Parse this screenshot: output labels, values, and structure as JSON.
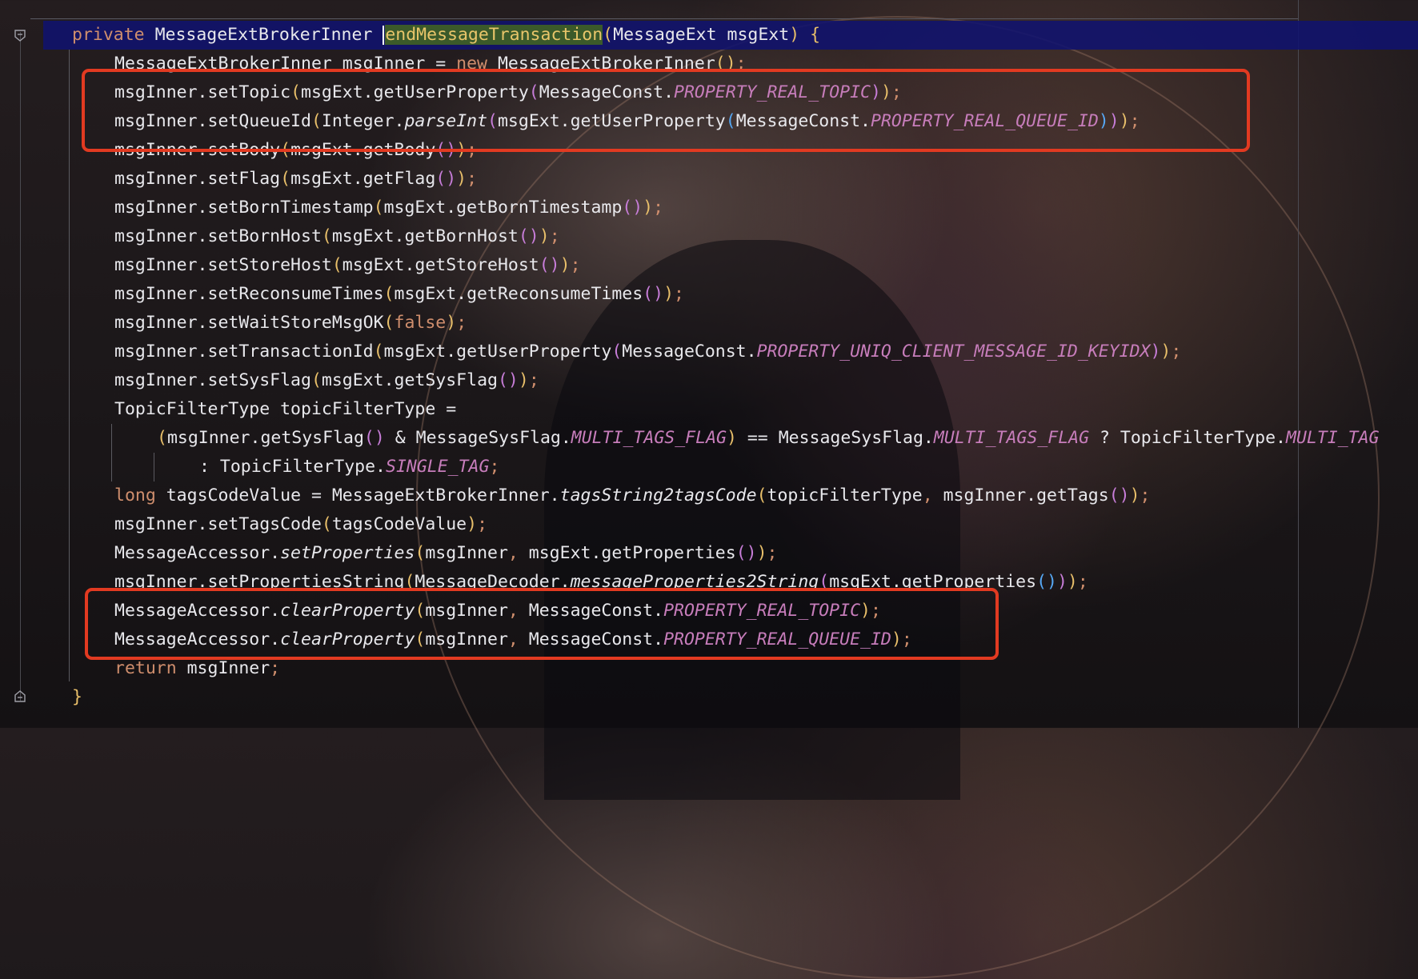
{
  "editor": {
    "lines": [
      {
        "indent": 0,
        "highlighted": true,
        "segments": [
          {
            "t": "private ",
            "c": "kw"
          },
          {
            "t": "MessageExtBrokerInner ",
            "c": "fn"
          },
          {
            "t": "",
            "c": "caret"
          },
          {
            "t": "endMessageTransaction",
            "c": "sel"
          },
          {
            "t": "(",
            "c": "p1"
          },
          {
            "t": "MessageExt msgExt",
            "c": "fn"
          },
          {
            "t": ") {",
            "c": "p1"
          }
        ]
      },
      {
        "indent": 1,
        "segments": [
          {
            "t": "MessageExtBrokerInner msgInner = ",
            "c": "fn"
          },
          {
            "t": "new ",
            "c": "kw"
          },
          {
            "t": "MessageExtBrokerInner",
            "c": "fn"
          },
          {
            "t": "()",
            "c": "p1"
          },
          {
            "t": ";",
            "c": "punc"
          }
        ]
      },
      {
        "indent": 1,
        "segments": [
          {
            "t": "msgInner.setTopic",
            "c": "fn"
          },
          {
            "t": "(",
            "c": "p1"
          },
          {
            "t": "msgExt.getUserProperty",
            "c": "fn"
          },
          {
            "t": "(",
            "c": "p2"
          },
          {
            "t": "MessageConst.",
            "c": "fn"
          },
          {
            "t": "PROPERTY_REAL_TOPIC",
            "c": "const"
          },
          {
            "t": ")",
            "c": "p2"
          },
          {
            "t": ")",
            "c": "p1"
          },
          {
            "t": ";",
            "c": "punc"
          }
        ]
      },
      {
        "indent": 1,
        "segments": [
          {
            "t": "msgInner.setQueueId",
            "c": "fn"
          },
          {
            "t": "(",
            "c": "p1"
          },
          {
            "t": "Integer.",
            "c": "fn"
          },
          {
            "t": "parseInt",
            "c": "st"
          },
          {
            "t": "(",
            "c": "p2"
          },
          {
            "t": "msgExt.getUserProperty",
            "c": "fn"
          },
          {
            "t": "(",
            "c": "p3"
          },
          {
            "t": "MessageConst.",
            "c": "fn"
          },
          {
            "t": "PROPERTY_REAL_QUEUE_ID",
            "c": "const"
          },
          {
            "t": ")",
            "c": "p3"
          },
          {
            "t": ")",
            "c": "p2"
          },
          {
            "t": ")",
            "c": "p1"
          },
          {
            "t": ";",
            "c": "punc"
          }
        ]
      },
      {
        "indent": 1,
        "segments": [
          {
            "t": "msgInner.setBody",
            "c": "fn"
          },
          {
            "t": "(",
            "c": "p1"
          },
          {
            "t": "msgExt.getBody",
            "c": "fn"
          },
          {
            "t": "()",
            "c": "p2"
          },
          {
            "t": ")",
            "c": "p1"
          },
          {
            "t": ";",
            "c": "punc"
          }
        ]
      },
      {
        "indent": 1,
        "segments": [
          {
            "t": "msgInner.setFlag",
            "c": "fn"
          },
          {
            "t": "(",
            "c": "p1"
          },
          {
            "t": "msgExt.getFlag",
            "c": "fn"
          },
          {
            "t": "()",
            "c": "p2"
          },
          {
            "t": ")",
            "c": "p1"
          },
          {
            "t": ";",
            "c": "punc"
          }
        ]
      },
      {
        "indent": 1,
        "segments": [
          {
            "t": "msgInner.setBornTimestamp",
            "c": "fn"
          },
          {
            "t": "(",
            "c": "p1"
          },
          {
            "t": "msgExt.getBornTimestamp",
            "c": "fn"
          },
          {
            "t": "()",
            "c": "p2"
          },
          {
            "t": ")",
            "c": "p1"
          },
          {
            "t": ";",
            "c": "punc"
          }
        ]
      },
      {
        "indent": 1,
        "segments": [
          {
            "t": "msgInner.setBornHost",
            "c": "fn"
          },
          {
            "t": "(",
            "c": "p1"
          },
          {
            "t": "msgExt.getBornHost",
            "c": "fn"
          },
          {
            "t": "()",
            "c": "p2"
          },
          {
            "t": ")",
            "c": "p1"
          },
          {
            "t": ";",
            "c": "punc"
          }
        ]
      },
      {
        "indent": 1,
        "segments": [
          {
            "t": "msgInner.setStoreHost",
            "c": "fn"
          },
          {
            "t": "(",
            "c": "p1"
          },
          {
            "t": "msgExt.getStoreHost",
            "c": "fn"
          },
          {
            "t": "()",
            "c": "p2"
          },
          {
            "t": ")",
            "c": "p1"
          },
          {
            "t": ";",
            "c": "punc"
          }
        ]
      },
      {
        "indent": 1,
        "segments": [
          {
            "t": "msgInner.setReconsumeTimes",
            "c": "fn"
          },
          {
            "t": "(",
            "c": "p1"
          },
          {
            "t": "msgExt.getReconsumeTimes",
            "c": "fn"
          },
          {
            "t": "()",
            "c": "p2"
          },
          {
            "t": ")",
            "c": "p1"
          },
          {
            "t": ";",
            "c": "punc"
          }
        ]
      },
      {
        "indent": 1,
        "segments": [
          {
            "t": "msgInner.setWaitStoreMsgOK",
            "c": "fn"
          },
          {
            "t": "(",
            "c": "p1"
          },
          {
            "t": "false",
            "c": "kw"
          },
          {
            "t": ")",
            "c": "p1"
          },
          {
            "t": ";",
            "c": "punc"
          }
        ]
      },
      {
        "indent": 1,
        "segments": [
          {
            "t": "msgInner.setTransactionId",
            "c": "fn"
          },
          {
            "t": "(",
            "c": "p1"
          },
          {
            "t": "msgExt.getUserProperty",
            "c": "fn"
          },
          {
            "t": "(",
            "c": "p2"
          },
          {
            "t": "MessageConst.",
            "c": "fn"
          },
          {
            "t": "PROPERTY_UNIQ_CLIENT_MESSAGE_ID_KEYIDX",
            "c": "const"
          },
          {
            "t": ")",
            "c": "p2"
          },
          {
            "t": ")",
            "c": "p1"
          },
          {
            "t": ";",
            "c": "punc"
          }
        ]
      },
      {
        "indent": 1,
        "segments": [
          {
            "t": "msgInner.setSysFlag",
            "c": "fn"
          },
          {
            "t": "(",
            "c": "p1"
          },
          {
            "t": "msgExt.getSysFlag",
            "c": "fn"
          },
          {
            "t": "()",
            "c": "p2"
          },
          {
            "t": ")",
            "c": "p1"
          },
          {
            "t": ";",
            "c": "punc"
          }
        ]
      },
      {
        "indent": 1,
        "segments": [
          {
            "t": "TopicFilterType topicFilterType =",
            "c": "fn"
          }
        ]
      },
      {
        "indent": 2,
        "segments": [
          {
            "t": "(",
            "c": "p1"
          },
          {
            "t": "msgInner.getSysFlag",
            "c": "fn"
          },
          {
            "t": "()",
            "c": "p2"
          },
          {
            "t": " & MessageSysFlag.",
            "c": "fn"
          },
          {
            "t": "MULTI_TAGS_FLAG",
            "c": "const"
          },
          {
            "t": ")",
            "c": "p1"
          },
          {
            "t": " == MessageSysFlag.",
            "c": "fn"
          },
          {
            "t": "MULTI_TAGS_FLAG",
            "c": "const"
          },
          {
            "t": " ? TopicFilterType.",
            "c": "fn"
          },
          {
            "t": "MULTI_TAG",
            "c": "const"
          }
        ]
      },
      {
        "indent": 3,
        "segments": [
          {
            "t": ": TopicFilterType.",
            "c": "fn"
          },
          {
            "t": "SINGLE_TAG",
            "c": "const"
          },
          {
            "t": ";",
            "c": "punc"
          }
        ]
      },
      {
        "indent": 1,
        "segments": [
          {
            "t": "long ",
            "c": "kw"
          },
          {
            "t": "tagsCodeValue = MessageExtBrokerInner.",
            "c": "fn"
          },
          {
            "t": "tagsString2tagsCode",
            "c": "st"
          },
          {
            "t": "(",
            "c": "p1"
          },
          {
            "t": "topicFilterType",
            "c": "fn"
          },
          {
            "t": ", ",
            "c": "punc"
          },
          {
            "t": "msgInner.getTags",
            "c": "fn"
          },
          {
            "t": "()",
            "c": "p2"
          },
          {
            "t": ")",
            "c": "p1"
          },
          {
            "t": ";",
            "c": "punc"
          }
        ]
      },
      {
        "indent": 1,
        "segments": [
          {
            "t": "msgInner.setTagsCode",
            "c": "fn"
          },
          {
            "t": "(",
            "c": "p1"
          },
          {
            "t": "tagsCodeValue",
            "c": "fn"
          },
          {
            "t": ")",
            "c": "p1"
          },
          {
            "t": ";",
            "c": "punc"
          }
        ]
      },
      {
        "indent": 1,
        "segments": [
          {
            "t": "MessageAccessor.",
            "c": "fn"
          },
          {
            "t": "setProperties",
            "c": "st"
          },
          {
            "t": "(",
            "c": "p1"
          },
          {
            "t": "msgInner",
            "c": "fn"
          },
          {
            "t": ", ",
            "c": "punc"
          },
          {
            "t": "msgExt.getProperties",
            "c": "fn"
          },
          {
            "t": "()",
            "c": "p2"
          },
          {
            "t": ")",
            "c": "p1"
          },
          {
            "t": ";",
            "c": "punc"
          }
        ]
      },
      {
        "indent": 1,
        "segments": [
          {
            "t": "msgInner.setPropertiesString",
            "c": "fn"
          },
          {
            "t": "(",
            "c": "p1"
          },
          {
            "t": "MessageDecoder.",
            "c": "fn"
          },
          {
            "t": "messageProperties2String",
            "c": "st"
          },
          {
            "t": "(",
            "c": "p2"
          },
          {
            "t": "msgExt.getProperties",
            "c": "fn"
          },
          {
            "t": "()",
            "c": "p3"
          },
          {
            "t": ")",
            "c": "p2"
          },
          {
            "t": ")",
            "c": "p1"
          },
          {
            "t": ";",
            "c": "punc"
          }
        ]
      },
      {
        "indent": 1,
        "segments": [
          {
            "t": "MessageAccessor.",
            "c": "fn"
          },
          {
            "t": "clearProperty",
            "c": "st"
          },
          {
            "t": "(",
            "c": "p1"
          },
          {
            "t": "msgInner",
            "c": "fn"
          },
          {
            "t": ", ",
            "c": "punc"
          },
          {
            "t": "MessageConst.",
            "c": "fn"
          },
          {
            "t": "PROPERTY_REAL_TOPIC",
            "c": "const"
          },
          {
            "t": ")",
            "c": "p1"
          },
          {
            "t": ";",
            "c": "punc"
          }
        ]
      },
      {
        "indent": 1,
        "segments": [
          {
            "t": "MessageAccessor.",
            "c": "fn"
          },
          {
            "t": "clearProperty",
            "c": "st"
          },
          {
            "t": "(",
            "c": "p1"
          },
          {
            "t": "msgInner",
            "c": "fn"
          },
          {
            "t": ", ",
            "c": "punc"
          },
          {
            "t": "MessageConst.",
            "c": "fn"
          },
          {
            "t": "PROPERTY_REAL_QUEUE_ID",
            "c": "const"
          },
          {
            "t": ")",
            "c": "p1"
          },
          {
            "t": ";",
            "c": "punc"
          }
        ]
      },
      {
        "indent": 1,
        "segments": [
          {
            "t": "return ",
            "c": "kw"
          },
          {
            "t": "msgInner",
            "c": "fn"
          },
          {
            "t": ";",
            "c": "punc"
          }
        ]
      },
      {
        "indent": 0,
        "segments": [
          {
            "t": "}",
            "c": "p1"
          }
        ]
      }
    ]
  },
  "colors": {
    "keyword": "#cf8e6d",
    "constant": "#c77dbb",
    "highlight_line": "#10126e",
    "annotation_box": "#e23a21"
  },
  "icons": {
    "fold_top": "fold-marker-icon",
    "fold_bottom": "fold-marker-icon"
  }
}
